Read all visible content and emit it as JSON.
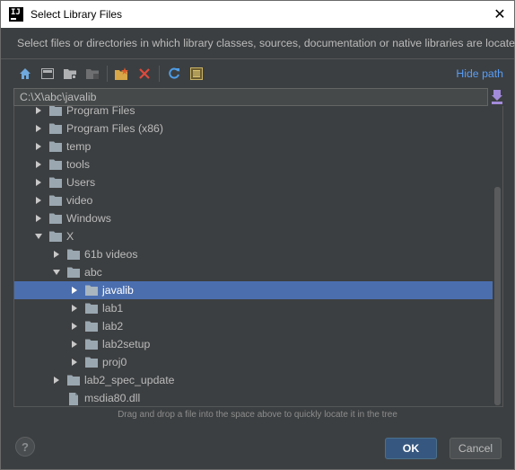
{
  "window": {
    "title": "Select Library Files",
    "close_glyph": "✕"
  },
  "description": "Select files or directories in which library classes, sources, documentation or native libraries are located",
  "toolbar": {
    "hide_path_label": "Hide path"
  },
  "path": {
    "value": "C:\\X\\abc\\javalib"
  },
  "tree": {
    "rows": [
      {
        "label": "Program Files",
        "expanded": false,
        "type": "folder"
      },
      {
        "label": "Program Files (x86)",
        "expanded": false,
        "type": "folder"
      },
      {
        "label": "temp",
        "expanded": false,
        "type": "folder"
      },
      {
        "label": "tools",
        "expanded": false,
        "type": "folder"
      },
      {
        "label": "Users",
        "expanded": false,
        "type": "folder"
      },
      {
        "label": "video",
        "expanded": false,
        "type": "folder"
      },
      {
        "label": "Windows",
        "expanded": false,
        "type": "folder"
      },
      {
        "label": "X",
        "expanded": true,
        "type": "folder"
      },
      {
        "label": "61b videos",
        "expanded": false,
        "type": "folder"
      },
      {
        "label": "abc",
        "expanded": true,
        "type": "folder"
      },
      {
        "label": "javalib",
        "expanded": false,
        "type": "folder",
        "selected": true
      },
      {
        "label": "lab1",
        "expanded": false,
        "type": "folder"
      },
      {
        "label": "lab2",
        "expanded": false,
        "type": "folder"
      },
      {
        "label": "lab2setup",
        "expanded": false,
        "type": "folder"
      },
      {
        "label": "proj0",
        "expanded": false,
        "type": "folder"
      },
      {
        "label": "lab2_spec_update",
        "expanded": false,
        "type": "folder"
      },
      {
        "label": "msdia80.dll",
        "type": "file"
      }
    ]
  },
  "hint": "Drag and drop a file into the space above to quickly locate it in the tree",
  "buttons": {
    "help_label": "?",
    "ok_label": "OK",
    "cancel_label": "Cancel"
  },
  "colors": {
    "background": "#3c3f41",
    "selection": "#4b6eaf",
    "link": "#589df6",
    "folder": "#9aa7b0"
  }
}
